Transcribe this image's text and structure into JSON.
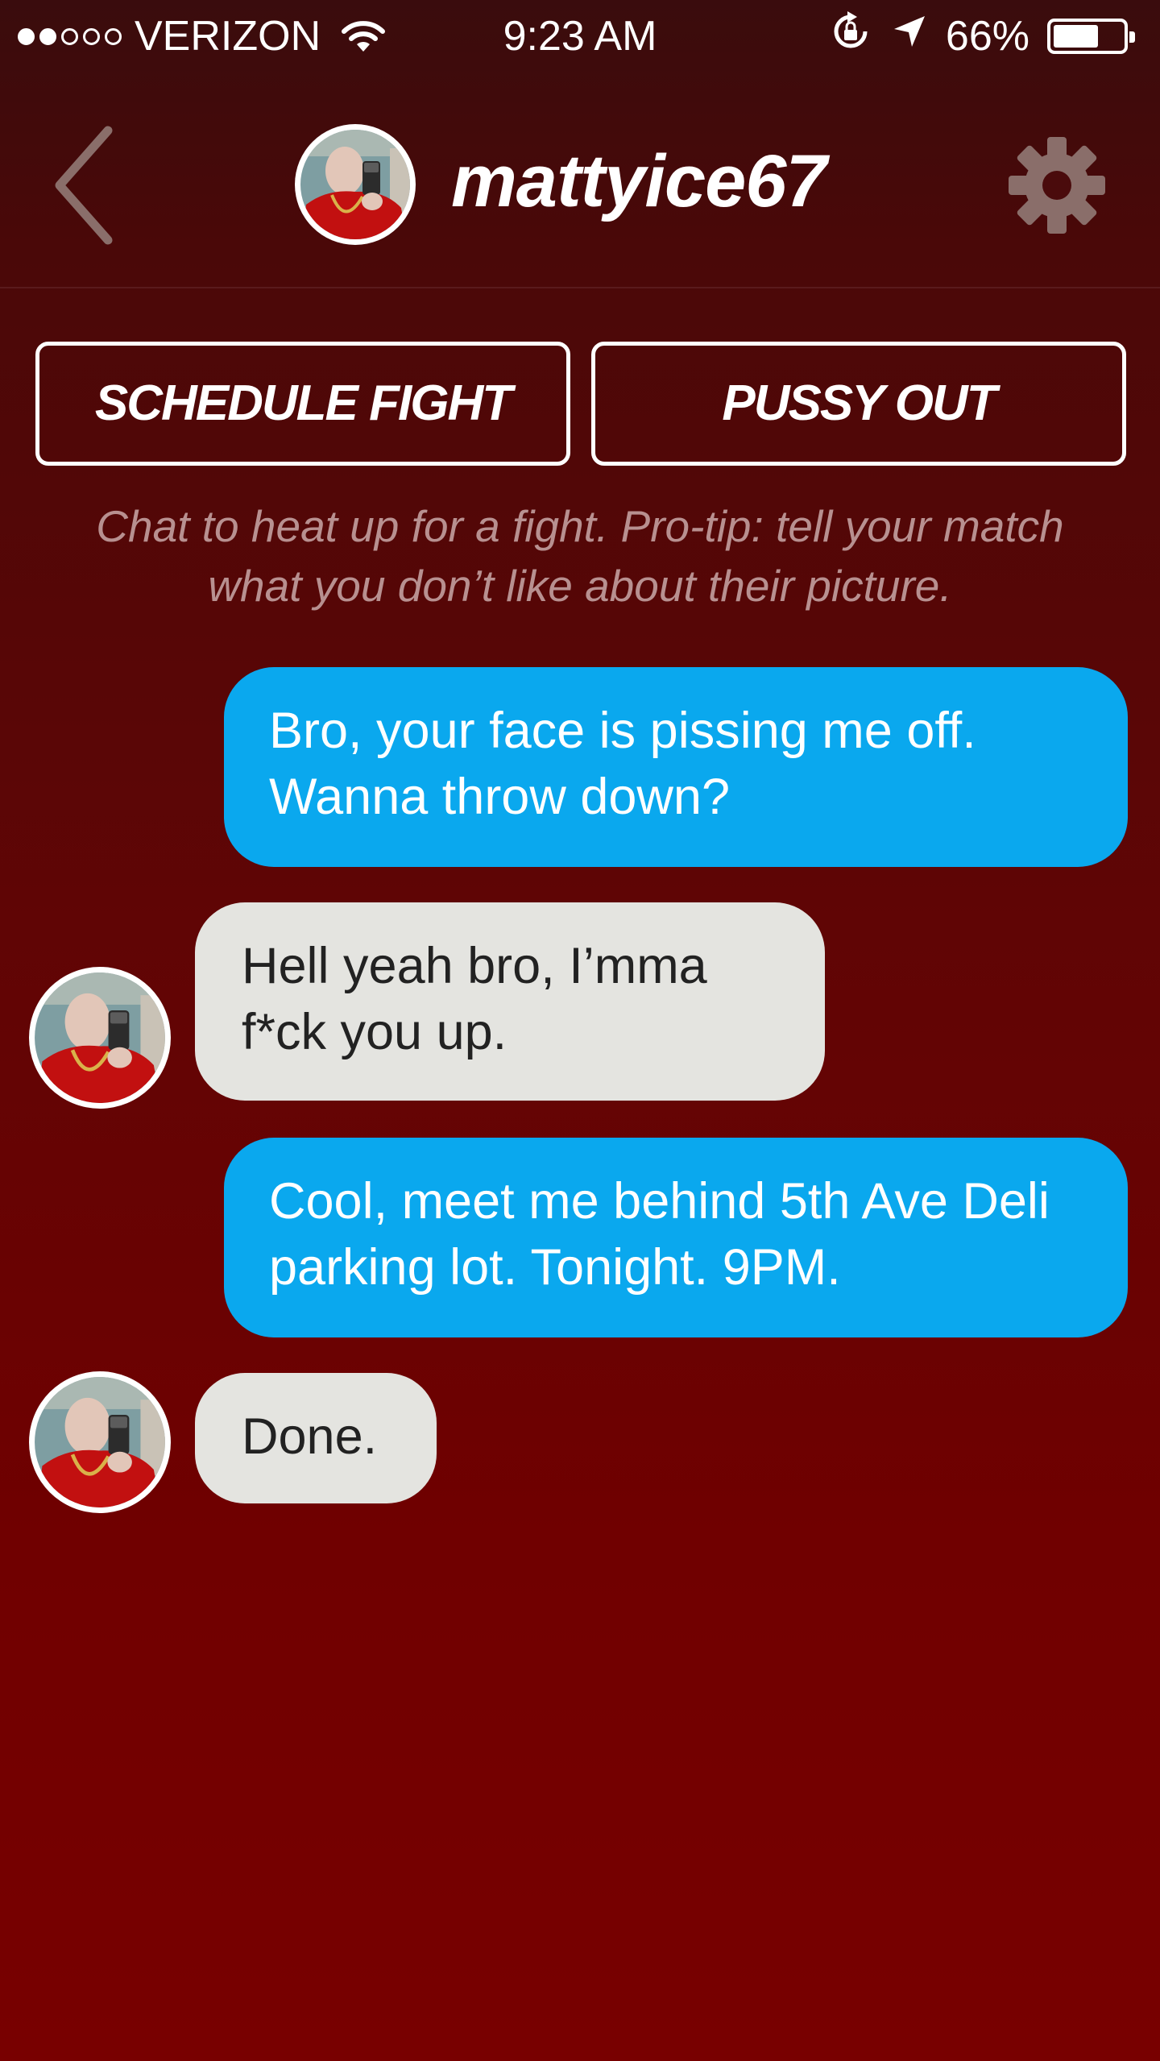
{
  "status_bar": {
    "carrier": "VERIZON",
    "signal_strength": 2,
    "time": "9:23 AM",
    "battery_percent": "66%",
    "battery_level": 0.66
  },
  "header": {
    "username": "mattyice67"
  },
  "actions": {
    "schedule_label": "SCHEDULE FIGHT",
    "pussy_out_label": "PUSSY OUT"
  },
  "tip": "Chat to heat up for a fight. Pro-tip: tell your match what you don’t like about their picture.",
  "messages": [
    {
      "sender": "me",
      "text": "Bro, your face is pissing me off. Wanna throw down?"
    },
    {
      "sender": "match",
      "text": "Hell yeah bro, I’mma f*ck you up."
    },
    {
      "sender": "me",
      "text": "Cool, meet me behind 5th Ave Deli parking lot. Tonight. 9PM."
    },
    {
      "sender": "match",
      "text": "Done."
    }
  ],
  "colors": {
    "background_top": "#3a0c0d",
    "background_bottom": "#780000",
    "outgoing_bubble": "#0aa8ee",
    "incoming_bubble": "#e4e4e0",
    "tip_text": "#b89090"
  },
  "icons": {
    "back": "chevron-left-icon",
    "settings": "gear-icon",
    "wifi": "wifi-icon",
    "rotation_lock": "rotation-lock-icon",
    "location": "location-arrow-icon",
    "battery": "battery-icon"
  }
}
